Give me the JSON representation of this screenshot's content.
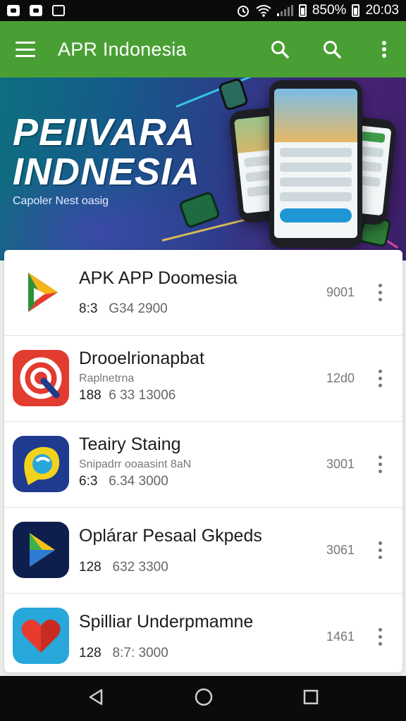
{
  "status_bar": {
    "battery_text": "850%",
    "time": "20:03"
  },
  "app_bar": {
    "title": "APR Indonesia"
  },
  "banner": {
    "title_line1": "PEIIVARA",
    "title_line2": "INDNESIA",
    "subtitle": "Capoler Nest oasig"
  },
  "apps": [
    {
      "name": "APK APP Doomesia",
      "subtitle": "",
      "meta_a": "8:3",
      "meta_b": "G34 2900",
      "size": "9001",
      "icon": "play-triangle-icon",
      "icon_bg": "#ffffff"
    },
    {
      "name": "Drooelrionapbat",
      "subtitle": "Raplnetrna",
      "meta_a": "188",
      "meta_b": "6 33 13006",
      "size": "12d0",
      "icon": "target-q-icon",
      "icon_bg": "#e23b2f"
    },
    {
      "name": "Teairy Staing",
      "subtitle": "Snipadrr ooaasint 8aN",
      "meta_a": "6:3",
      "meta_b": "6.34 3000",
      "size": "3001",
      "icon": "chat-globe-icon",
      "icon_bg": "#1f3b8f"
    },
    {
      "name": "Oplárar Pesaal Gkpeds",
      "subtitle": "",
      "meta_a": "128",
      "meta_b": "632 3300",
      "size": "3061",
      "icon": "play-arrow-icon",
      "icon_bg": "#0e1f4d"
    },
    {
      "name": "Spilliar Underpmamne",
      "subtitle": "",
      "meta_a": "128",
      "meta_b": "8:7: 3000",
      "size": "1461",
      "icon": "heart-icon",
      "icon_bg": "#27a7da"
    }
  ]
}
